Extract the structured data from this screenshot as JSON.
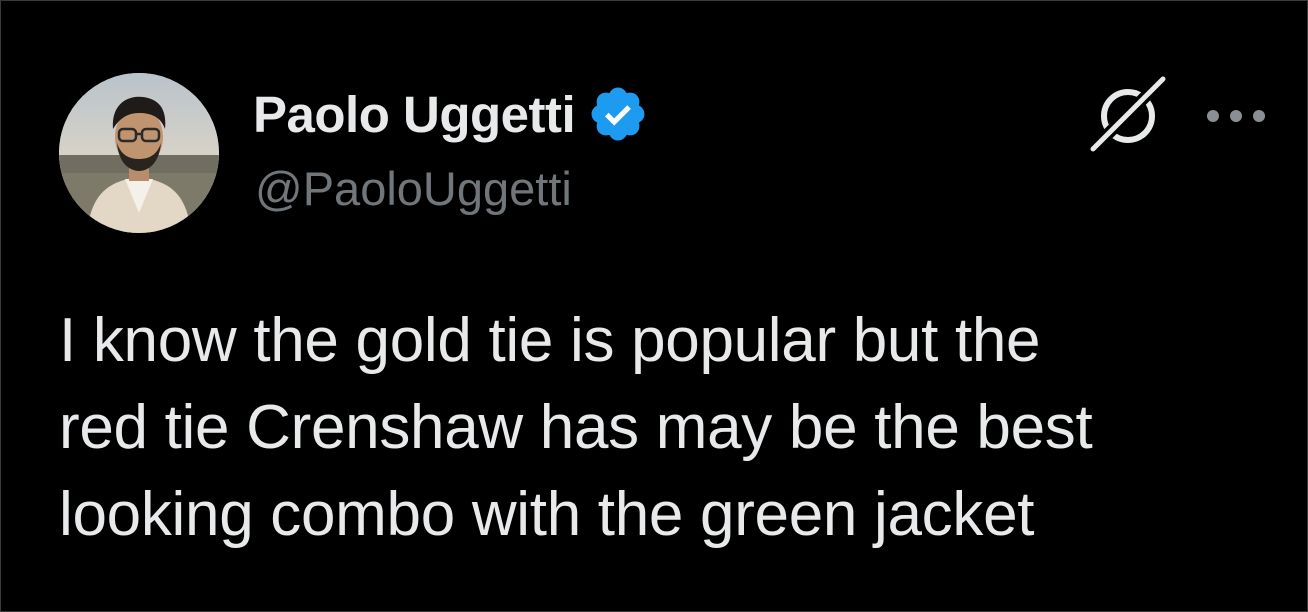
{
  "author": {
    "display_name": "Paolo Uggetti",
    "handle": "@PaoloUggetti",
    "verified": true,
    "verified_color": "#1d9bf0"
  },
  "tweet": {
    "lines": [
      "I know the gold tie is popular but the",
      "red tie Crenshaw has may be the best",
      "looking combo with the green jacket"
    ]
  },
  "icons": {
    "avatar": "avatar",
    "verified": "verified-badge-icon",
    "grok": "grok-icon",
    "more": "more-options-icon"
  },
  "colors": {
    "background": "#000000",
    "text_primary": "#e7e9ea",
    "text_secondary": "#71767b"
  }
}
